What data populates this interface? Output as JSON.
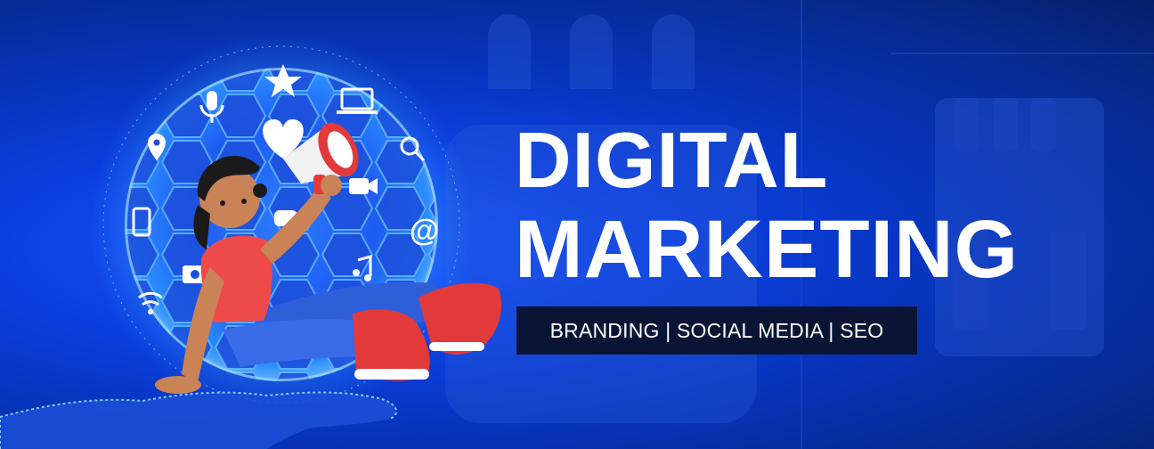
{
  "headline": {
    "line1": "DIGITAL",
    "line2": "MARKETING"
  },
  "tagline": "BRANDING | SOCIAL MEDIA | SEO",
  "colors": {
    "background": "#0733b8",
    "headline": "#ffffff",
    "tagline_bg": "#0a1535",
    "globe_glow": "#3a8bff",
    "shirt": "#ef4a4a",
    "pants": "#2f5fd8",
    "shoes": "#e23a3a"
  },
  "icons": [
    "microphone-icon",
    "star-icon",
    "laptop-icon",
    "heart-icon",
    "location-pin-icon",
    "megaphone-icon",
    "search-icon",
    "video-camera-icon",
    "tablet-icon",
    "at-sign-icon",
    "camera-icon",
    "music-note-icon",
    "wifi-icon",
    "chat-bubble-icon"
  ]
}
